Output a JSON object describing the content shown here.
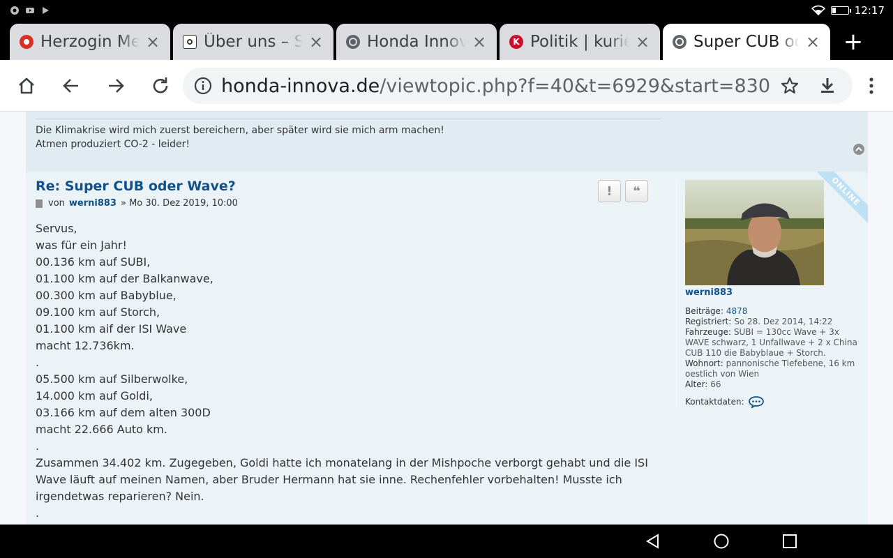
{
  "status_bar": {
    "time": "12:17"
  },
  "tabs": [
    {
      "title": "Herzogin Meghan",
      "fav_color": "#d93025",
      "fav_glyph": "◉"
    },
    {
      "title": "Über uns – SoundCloud",
      "fav_color": "#ffffff",
      "fav_glyph": "⊙"
    },
    {
      "title": "Honda Innova",
      "fav_color": "#5f6368",
      "fav_glyph": ""
    },
    {
      "title": "Politik | kurier.at",
      "fav_color": "#c8102e",
      "fav_glyph": "K"
    },
    {
      "title": "Super CUB oder Wave?",
      "fav_color": "#5f6368",
      "fav_glyph": ""
    }
  ],
  "omnibox": {
    "host": "honda-innova.de",
    "path": "/viewtopic.php?f=40&t=6929&start=830"
  },
  "prev_post": {
    "signature": [
      "Die Klimakrise wird mich zuerst bereichern, aber später wird sie mich arm machen!",
      "Atmen produziert CO-2 - leider!"
    ]
  },
  "post": {
    "title": "Re: Super CUB oder Wave?",
    "meta_prefix": "von",
    "author": "werni883",
    "date": "» Mo 30. Dez 2019, 10:00",
    "report_label": "!",
    "quote_label": "❝",
    "lines": [
      "Servus,",
      "was für ein Jahr!",
      "00.136 km auf SUBI,",
      "01.100 km auf der Balkanwave,",
      "00.300 km auf Babyblue,",
      "09.100 km auf Storch,",
      "01.100 km aif der ISI Wave",
      "macht 12.736km.",
      ".",
      "05.500 km auf Silberwolke,",
      "14.000 km auf Goldi,",
      "03.166 km auf dem alten 300D",
      "macht 22.666 Auto km.",
      ".",
      "Zusammen 34.402 km. Zugegeben, Goldi hatte ich monatelang in der Mishpoche verborgt gehabt und die ISI Wave läuft auf meinen Namen, aber Bruder Hermann hat sie inne. Rechenfehler vorbehalten! Musste ich irgendetwas reparieren? Nein.",
      "."
    ]
  },
  "profile": {
    "ribbon": "ONLINE",
    "username": "werni883",
    "posts_label": "Beiträge:",
    "posts_value": "4878",
    "registered_label": "Registriert:",
    "registered_value": "So 28. Dez 2014, 14:22",
    "vehicles_label": "Fahrzeuge:",
    "vehicles_value": "SUBI = 130cc Wave + 3x WAVE schwarz, 1 Unfallwave + 2 x China CUB 110 die Babyblaue + Storch.",
    "location_label": "Wohnort:",
    "location_value": "pannonische Tiefebene, 16 km oestlich von Wien",
    "age_label": "Alter:",
    "age_value": "66",
    "contact_label": "Kontaktdaten:"
  }
}
